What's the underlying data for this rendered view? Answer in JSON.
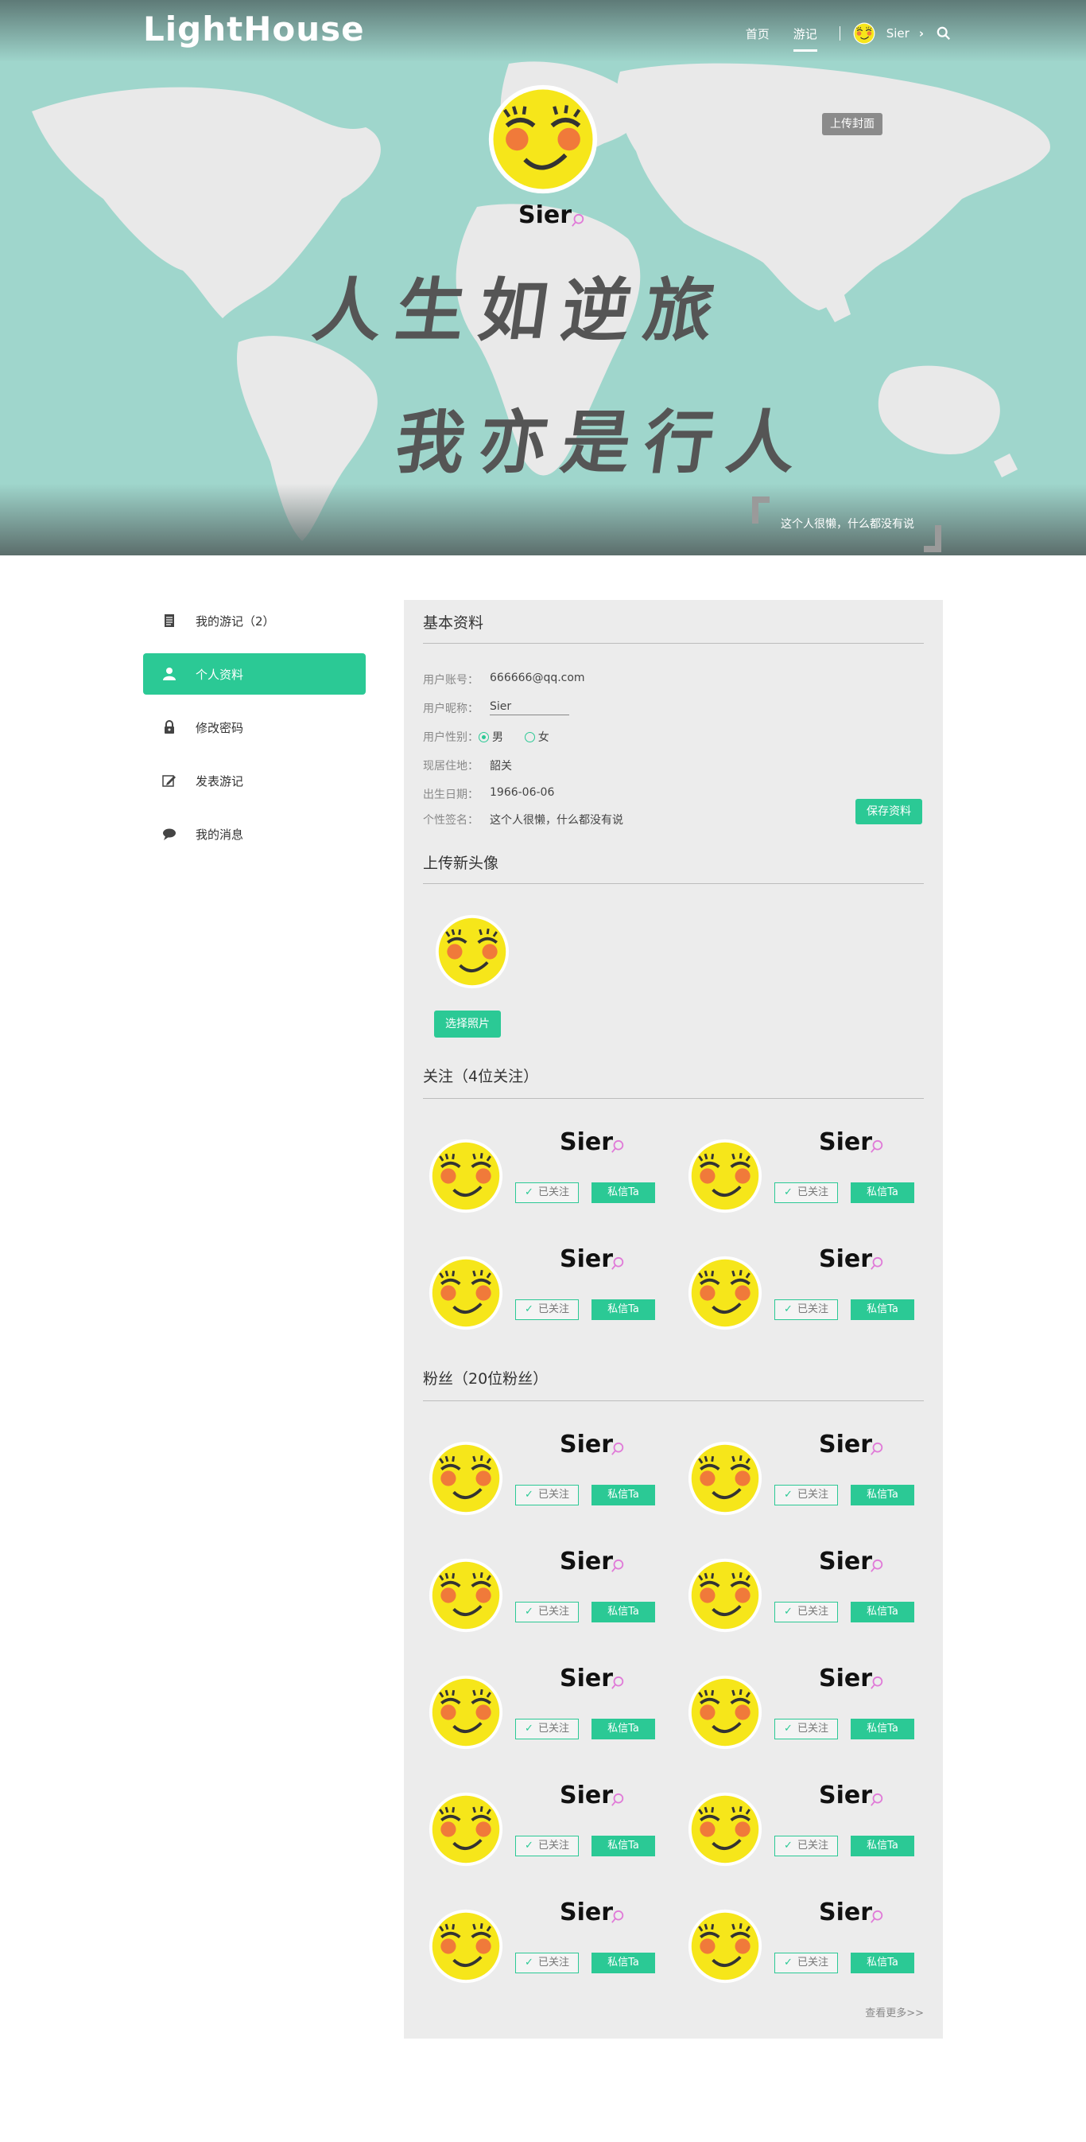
{
  "header": {
    "logo": "LightHouse",
    "nav": [
      {
        "label": "首页",
        "active": false
      },
      {
        "label": "游记",
        "active": true
      }
    ],
    "user_name": "Sier",
    "icons": [
      "smiley-avatar",
      "chevron-right-icon",
      "search-icon"
    ]
  },
  "hero": {
    "upload_cover": "上传封面",
    "user_name": "Sier",
    "slogan_line1": "人生如逆旅",
    "slogan_line2": "我亦是行人",
    "signature": "这个人很懒，什么都没有说"
  },
  "sidebar": {
    "items": [
      {
        "label": "我的游记（2）",
        "icon": "document-icon",
        "active": false
      },
      {
        "label": "个人资料",
        "icon": "user-icon",
        "active": true
      },
      {
        "label": "修改密码",
        "icon": "lock-icon",
        "active": false
      },
      {
        "label": "发表游记",
        "icon": "edit-icon",
        "active": false
      },
      {
        "label": "我的消息",
        "icon": "chat-icon",
        "active": false
      }
    ]
  },
  "profile": {
    "title": "基本资料",
    "account_label": "用户账号：",
    "account_value": "666666@qq.com",
    "nickname_label": "用户昵称：",
    "nickname_value": "Sier",
    "gender_label": "用户性别：",
    "gender_male": "男",
    "gender_female": "女",
    "gender_selected": "男",
    "residence_label": "现居住地：",
    "residence_value": "韶关",
    "birthday_label": "出生日期：",
    "birthday_value": "1966-06-06",
    "signature_label": "个性签名：",
    "signature_value": "这个人很懒，什么都没有说",
    "save_button": "保存资料"
  },
  "avatar_upload": {
    "title": "上传新头像",
    "choose_button": "选择照片"
  },
  "following": {
    "title": "关注（4位关注）",
    "users": [
      {
        "name": "Sier",
        "follow_label": "已关注",
        "message_label": "私信Ta"
      },
      {
        "name": "Sier",
        "follow_label": "已关注",
        "message_label": "私信Ta"
      },
      {
        "name": "Sier",
        "follow_label": "已关注",
        "message_label": "私信Ta"
      },
      {
        "name": "Sier",
        "follow_label": "已关注",
        "message_label": "私信Ta"
      }
    ]
  },
  "fans": {
    "title": "粉丝（20位粉丝）",
    "users": [
      {
        "name": "Sier",
        "follow_label": "已关注",
        "message_label": "私信Ta"
      },
      {
        "name": "Sier",
        "follow_label": "已关注",
        "message_label": "私信Ta"
      },
      {
        "name": "Sier",
        "follow_label": "已关注",
        "message_label": "私信Ta"
      },
      {
        "name": "Sier",
        "follow_label": "已关注",
        "message_label": "私信Ta"
      },
      {
        "name": "Sier",
        "follow_label": "已关注",
        "message_label": "私信Ta"
      },
      {
        "name": "Sier",
        "follow_label": "已关注",
        "message_label": "私信Ta"
      },
      {
        "name": "Sier",
        "follow_label": "已关注",
        "message_label": "私信Ta"
      },
      {
        "name": "Sier",
        "follow_label": "已关注",
        "message_label": "私信Ta"
      },
      {
        "name": "Sier",
        "follow_label": "已关注",
        "message_label": "私信Ta"
      },
      {
        "name": "Sier",
        "follow_label": "已关注",
        "message_label": "私信Ta"
      }
    ],
    "more_link": "查看更多>>"
  },
  "colors": {
    "accent": "#2bc995",
    "hero_bg": "#9fd6cc",
    "panel_bg": "#ececec"
  }
}
